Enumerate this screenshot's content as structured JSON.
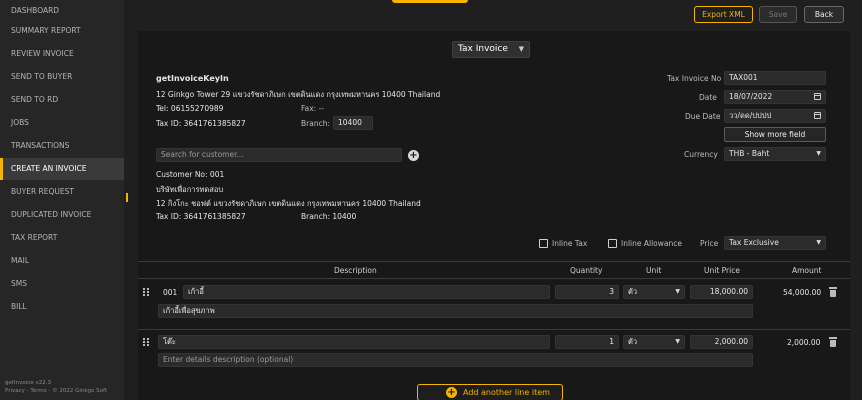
{
  "sidebar": {
    "items": [
      {
        "label": "DASHBOARD"
      },
      {
        "label": "SUMMARY REPORT"
      },
      {
        "label": "REVIEW INVOICE"
      },
      {
        "label": "SEND TO BUYER"
      },
      {
        "label": "SEND TO RD"
      },
      {
        "label": "JOBS"
      },
      {
        "label": "TRANSACTIONS"
      },
      {
        "label": "CREATE AN INVOICE"
      },
      {
        "label": "BUYER REQUEST"
      },
      {
        "label": "DUPLICATED INVOICE"
      },
      {
        "label": "TAX REPORT"
      },
      {
        "label": "MAIL"
      },
      {
        "label": "SMS"
      },
      {
        "label": "BILL"
      }
    ],
    "active_index": 7,
    "version": "getInvoice v22.3",
    "footer_links": "Privacy  -  Terms  -  © 2022 Ginkgo Soft"
  },
  "toolbar": {
    "export_label": "Export XML",
    "save_label": "Save",
    "back_label": "Back"
  },
  "document": {
    "type": "Tax Invoice"
  },
  "seller": {
    "name": "getInvoiceKeyIn",
    "address": "12 Ginkgo Tower 29 แขวงรัชดาภิเษก เขตดินแดง กรุงเทพมหานคร 10400 Thailand",
    "tel": "Tel: 06155270989",
    "fax": "Fax: --",
    "tax_id": "Tax ID: 3641761385827",
    "branch_label": "Branch:",
    "branch_value": "10400"
  },
  "customer": {
    "search_placeholder": "Search for customer...",
    "customer_no": "Customer No: 001",
    "name": "บริษัทเพื่อการทดสอบ",
    "address": "12 กิงโกะ ชอฟต์ แขวงรัชดาภิเษก เขตดินแดง กรุงเทพมหานคร 10400 Thailand",
    "tax_id": "Tax ID: 3641761385827",
    "branch": "Branch: 10400"
  },
  "meta": {
    "tax_invoice_no_label": "Tax Invoice No",
    "tax_invoice_no": "TAX001",
    "date_label": "Date",
    "date": "18/07/2022",
    "due_date_label": "Due Date",
    "due_date_placeholder": "วว/ดด/ปปปป",
    "show_more_label": "Show more field",
    "currency_label": "Currency",
    "currency": "THB - Baht"
  },
  "options": {
    "inline_tax": "Inline Tax",
    "inline_allowance": "Inline Allowance",
    "price_label": "Price",
    "price_mode": "Tax Exclusive"
  },
  "table": {
    "headers": {
      "description": "Description",
      "quantity": "Quantity",
      "unit": "Unit",
      "unit_price": "Unit Price",
      "amount": "Amount"
    },
    "rows": [
      {
        "code": "001",
        "name": "เก้าอี้",
        "details": "เก้าอี้เพื่อสุขภาพ",
        "quantity": "3",
        "unit": "ตัว",
        "unit_price": "18,000.00",
        "amount": "54,000.00"
      },
      {
        "code": "",
        "name": "โต๊ะ",
        "details_placeholder": "Enter details description (optional)",
        "quantity": "1",
        "unit": "ตัว",
        "unit_price": "2,000.00",
        "amount": "2,000.00"
      }
    ],
    "add_line_label": "Add another line item"
  },
  "colors": {
    "accent": "#f5b400",
    "sidebar_bg": "#262626",
    "content_bg": "#1f1f1f",
    "card_bg": "#181818"
  }
}
